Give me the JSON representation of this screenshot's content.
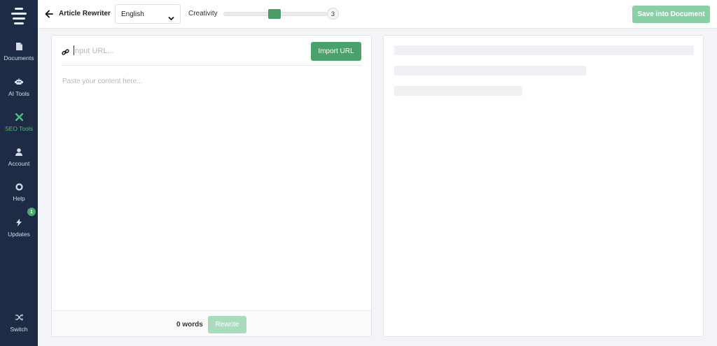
{
  "sidebar": {
    "items": [
      {
        "label": "Documents",
        "icon": "document-icon"
      },
      {
        "label": "AI Tools",
        "icon": "robot-icon"
      },
      {
        "label": "SEO Tools",
        "icon": "seo-tools-icon",
        "active": true
      },
      {
        "label": "Account",
        "icon": "user-icon"
      },
      {
        "label": "Help",
        "icon": "lifebuoy-icon"
      },
      {
        "label": "Updates",
        "icon": "bolt-icon",
        "badge": "1"
      },
      {
        "label": "Switch",
        "icon": "shuffle-icon"
      }
    ]
  },
  "header": {
    "title": "Article Rewriter",
    "language": "English",
    "creativity_label": "Creativity",
    "creativity_value": "3",
    "save_label": "Save into Document"
  },
  "editor": {
    "url_placeholder": "Input URL...",
    "import_label": "Import URL",
    "content_placeholder": "Paste your content here...",
    "word_count": "0 words",
    "rewrite_label": "Rewrite"
  },
  "colors": {
    "sidebar_bg": "#1d2b45",
    "accent": "#4aa16b",
    "accent_disabled": "#a9dbbd",
    "active_nav": "#4fbf7b"
  }
}
